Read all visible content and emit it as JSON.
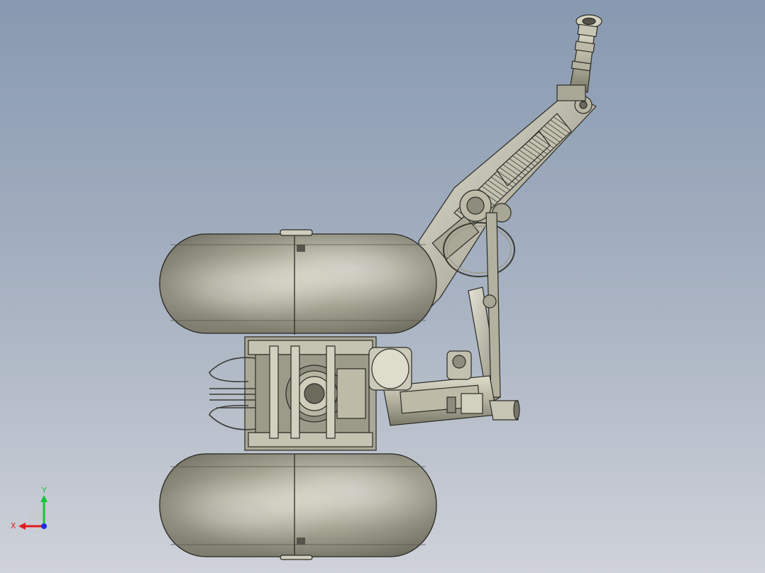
{
  "viewport": {
    "background_top": "#8799b0",
    "background_bottom": "#cfd2d9"
  },
  "model": {
    "part_color": "#c9c8b6",
    "edge_color": "#2b2b26"
  },
  "triad": {
    "x_label": "X",
    "y_label": "Y",
    "x_color": "#e31a1a",
    "y_color": "#17c43a",
    "z_color": "#1b2ee0"
  }
}
